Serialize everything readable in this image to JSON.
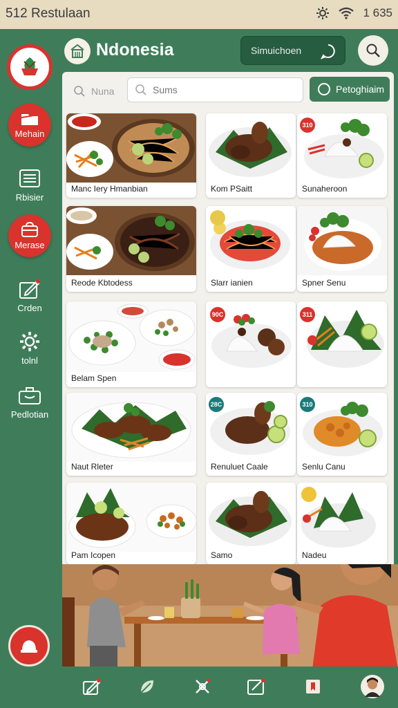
{
  "status": {
    "title": "512 Restulaan",
    "time": "1 635"
  },
  "header": {
    "brand": "Ndonesia",
    "sim_button": "Simuichoen"
  },
  "sidebar": {
    "items": [
      {
        "label": "Mehain",
        "icon": "folder-icon",
        "active": true
      },
      {
        "label": "Rbisier",
        "icon": "list-icon",
        "active": false
      },
      {
        "label": "Merase",
        "icon": "bag-icon",
        "active": true
      },
      {
        "label": "Crden",
        "icon": "edit-icon",
        "active": false
      },
      {
        "label": "tolnl",
        "icon": "gear-icon",
        "active": false
      },
      {
        "label": "Pedlotian",
        "icon": "briefcase-icon",
        "active": false
      }
    ]
  },
  "filters": {
    "chip": "Nuna",
    "search_placeholder": "Sums",
    "action": "Petoghiaim"
  },
  "menu": [
    {
      "name": "Manc Iery Hmanbian"
    },
    {
      "name": "Kom PSaitt",
      "badge": ""
    },
    {
      "name": "Sunaheroon",
      "badge": "310"
    },
    {
      "name": "Reode Kbtodess"
    },
    {
      "name": "Slarr ianien"
    },
    {
      "name": "Spner Senu"
    },
    {
      "name": "Belam Spen"
    },
    {
      "name": "",
      "badge": "90C"
    },
    {
      "name": "",
      "badge": "311"
    },
    {
      "name": "Naut Rleter"
    },
    {
      "name": "Renuluet Caale",
      "badge": "28C"
    },
    {
      "name": "Senlu Canu",
      "badge": "310"
    },
    {
      "name": "Pam Icopen"
    },
    {
      "name": "Samo"
    },
    {
      "name": "Nadeu",
      "badge": ""
    }
  ],
  "colors": {
    "brand_green": "#3f7d5a",
    "accent_red": "#d8332d",
    "dark_green": "#265c40"
  }
}
